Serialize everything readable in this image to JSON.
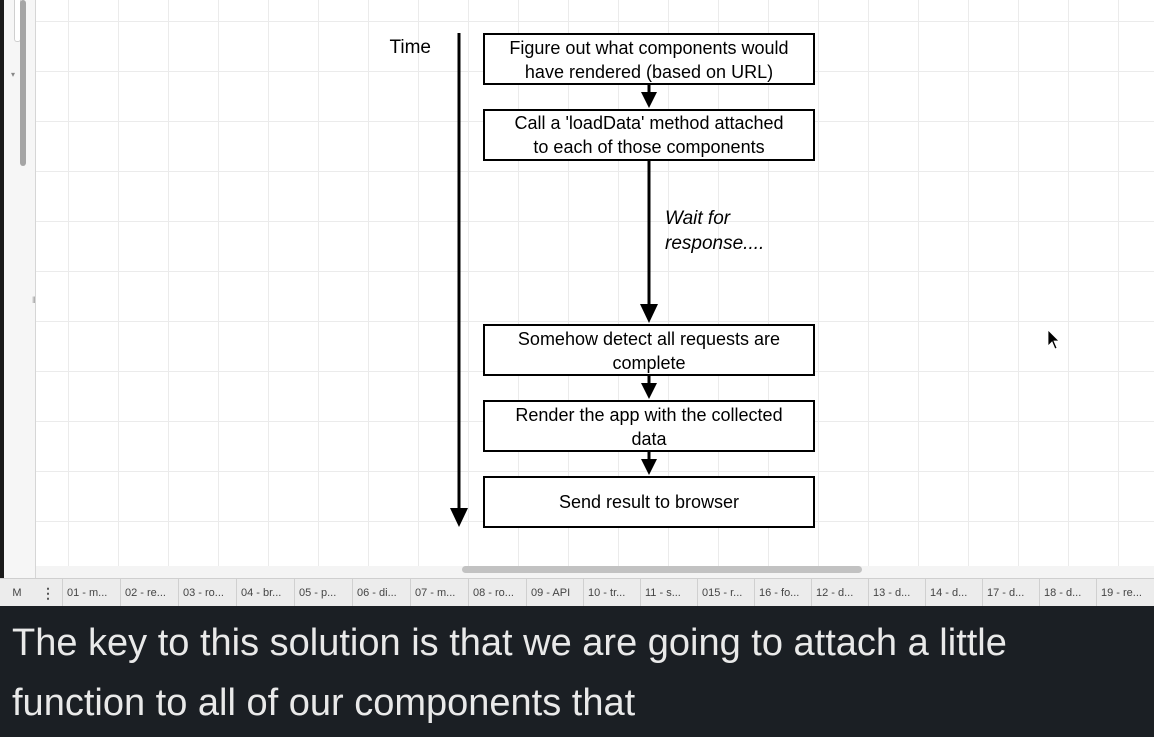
{
  "diagram": {
    "time_label": "Time",
    "boxes": [
      {
        "line1": "Figure out what components would",
        "line2": "have rendered (based on URL)"
      },
      {
        "line1": "Call a 'loadData' method attached",
        "line2": "to each of those components"
      },
      {
        "line1": "Somehow detect all requests are",
        "line2": "complete"
      },
      {
        "line1": "Render the app with the collected",
        "line2": "data"
      },
      {
        "line1": "Send result to browser"
      }
    ],
    "wait_note": {
      "line1": "Wait for",
      "line2": "response...."
    }
  },
  "tabbar": {
    "first_label": "M",
    "menu_glyph": "⋮",
    "tabs": [
      "01 - m...",
      "02 - re...",
      "03 - ro...",
      "04 - br...",
      "05 - p...",
      "06 - di...",
      "07 - m...",
      "08 - ro...",
      "09 - API",
      "10 - tr...",
      "11 - s...",
      "015 - r...",
      "16 - fo...",
      "12 - d...",
      "13 - d...",
      "14 - d...",
      "17 - d...",
      "18 - d...",
      "19 - re..."
    ]
  },
  "caption": {
    "line1": "The key to this solution is that we are going to attach a little",
    "line2": "function to all of our components that"
  }
}
